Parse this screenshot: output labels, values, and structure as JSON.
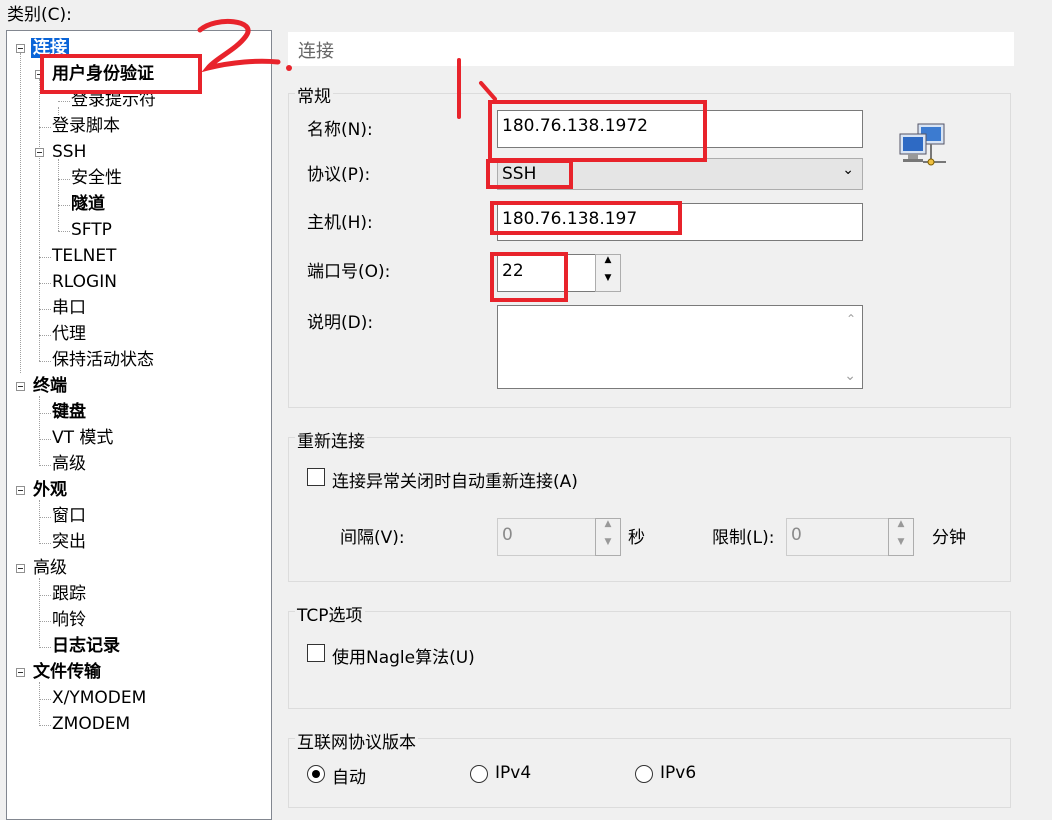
{
  "category_label": "类别(C):",
  "tree": {
    "items": [
      {
        "label": "连接"
      },
      {
        "label": "用户身份验证"
      },
      {
        "label": "登录提示符"
      },
      {
        "label": "登录脚本"
      },
      {
        "label": "SSH"
      },
      {
        "label": "安全性"
      },
      {
        "label": "隧道"
      },
      {
        "label": "SFTP"
      },
      {
        "label": "TELNET"
      },
      {
        "label": "RLOGIN"
      },
      {
        "label": "串口"
      },
      {
        "label": "代理"
      },
      {
        "label": "保持活动状态"
      },
      {
        "label": "终端"
      },
      {
        "label": "键盘"
      },
      {
        "label": "VT 模式"
      },
      {
        "label": "高级"
      },
      {
        "label": "外观"
      },
      {
        "label": "窗口"
      },
      {
        "label": "突出"
      },
      {
        "label": "高级"
      },
      {
        "label": "跟踪"
      },
      {
        "label": "响铃"
      },
      {
        "label": "日志记录"
      },
      {
        "label": "文件传输"
      },
      {
        "label": "X/YMODEM"
      },
      {
        "label": "ZMODEM"
      }
    ]
  },
  "panel_title": "连接",
  "general": {
    "group_label": "常规",
    "name_label": "名称(N):",
    "name_value": "180.76.138.1972",
    "protocol_label": "协议(P):",
    "protocol_value": "SSH",
    "host_label": "主机(H):",
    "host_value": "180.76.138.197",
    "port_label": "端口号(O):",
    "port_value": "22",
    "desc_label": "说明(D):",
    "desc_value": ""
  },
  "reconnect": {
    "group_label": "重新连接",
    "auto_reconnect_label": "连接异常关闭时自动重新连接(A)",
    "interval_label": "间隔(V):",
    "interval_value": "0",
    "interval_unit": "秒",
    "limit_label": "限制(L):",
    "limit_value": "0",
    "limit_unit": "分钟"
  },
  "tcp": {
    "group_label": "TCP选项",
    "nagle_label": "使用Nagle算法(U)"
  },
  "ip_version": {
    "group_label": "互联网协议版本",
    "options": [
      {
        "label": "自动",
        "selected": true
      },
      {
        "label": "IPv4",
        "selected": false
      },
      {
        "label": "IPv6",
        "selected": false
      }
    ]
  },
  "annotations": {
    "step1": "1.",
    "step2": "2."
  },
  "colors": {
    "selection": "#0a64d8",
    "annotation_red": "#e8232b"
  },
  "icons": [
    "network-computers-icon"
  ]
}
